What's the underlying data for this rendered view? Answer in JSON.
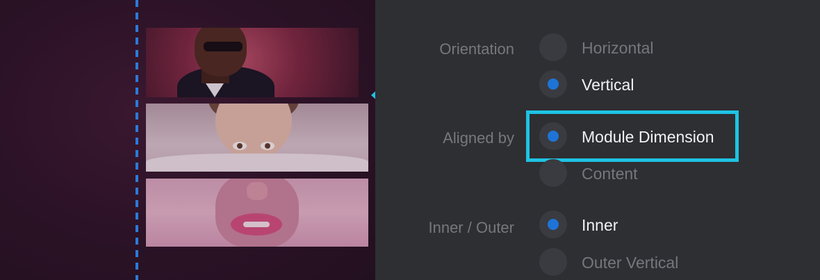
{
  "settings": {
    "orientation": {
      "label": "Orientation",
      "options": [
        {
          "label": "Horizontal",
          "selected": false
        },
        {
          "label": "Vertical",
          "selected": true
        }
      ]
    },
    "aligned_by": {
      "label": "Aligned by",
      "options": [
        {
          "label": "Module Dimension",
          "selected": true
        },
        {
          "label": "Content",
          "selected": false
        }
      ]
    },
    "inner_outer": {
      "label": "Inner / Outer",
      "options": [
        {
          "label": "Inner",
          "selected": true
        },
        {
          "label": "Outer Vertical",
          "selected": false
        }
      ]
    }
  },
  "colors": {
    "accent_radio": "#1e74d6",
    "highlight_border": "#1fc3e4",
    "arrow": "#1fc3e4",
    "guide_line": "#2a7bdc"
  },
  "icons": {
    "arrow": "left-arrow-icon"
  }
}
